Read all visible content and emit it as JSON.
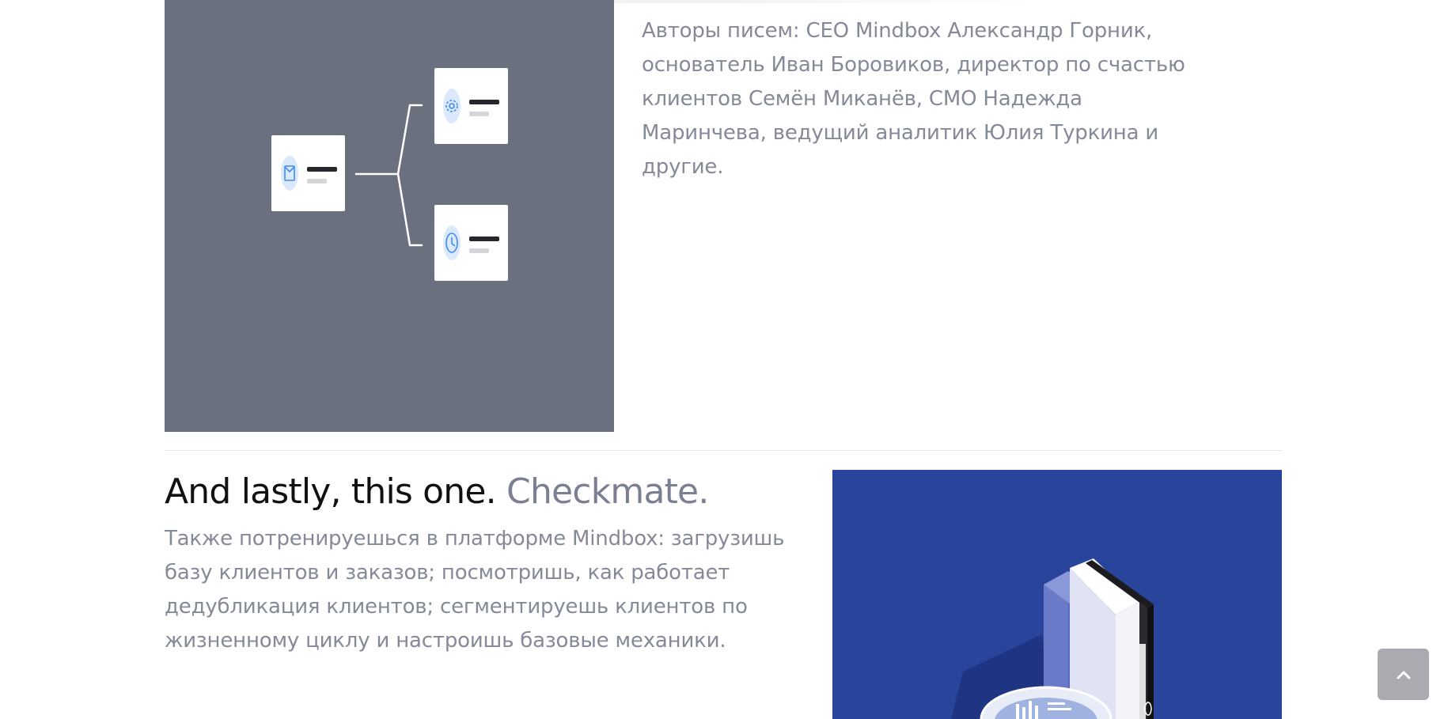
{
  "section_authors": {
    "paragraph": "Авторы писем: CEO Mindbox Александр Горник, основатель Иван Боровиков, директор по счастью клиентов Семён Миканёв, CMO Надежда Маринчева, ведущий аналитик Юлия Туркина и другие."
  },
  "section_checkmate": {
    "title_main": "And lastly, this one.",
    "title_accent": "Checkmate.",
    "paragraph": "Также потренируешься в платформе Mindbox: загрузишь базу клиентов и заказов; посмотришь, как работает дедубликация клиентов; сегментируешь клиентов по жизненному циклу и настроишь базовые механики."
  },
  "colors": {
    "flow_image_background": "#6b707f",
    "binders_image_background": "#29449b",
    "accent_gray": "#7a8091",
    "body_text": "#858a99",
    "icon_blue": "#3d8ef0"
  },
  "icons": {
    "flow_nodes": [
      "mail-icon",
      "gear-icon",
      "clock-icon"
    ],
    "scroll_top": "chevron-up-icon"
  }
}
